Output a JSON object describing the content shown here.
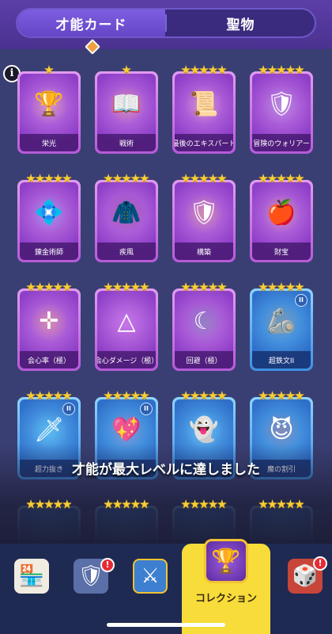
{
  "tabs": [
    {
      "label": "才能カード",
      "active": true
    },
    {
      "label": "聖物",
      "active": false
    }
  ],
  "info_icon": "info-icon",
  "cards": [
    {
      "label": "栄光",
      "stars": 1,
      "icon": "trophy-icon",
      "glyph": "🏆",
      "theme": "purple",
      "art_color": "#f4d35e"
    },
    {
      "label": "戦術",
      "stars": 1,
      "icon": "tactics-book-icon",
      "glyph": "📖",
      "theme": "purple",
      "art_color": "#f6b93b"
    },
    {
      "label": "最後のエキスパート",
      "stars": 5,
      "icon": "scroll-icon",
      "glyph": "📜",
      "theme": "purple",
      "art_color": "#f1d28a"
    },
    {
      "label": "冒険のウォリアー",
      "stars": 5,
      "icon": "armor-icon",
      "glyph": "🛡",
      "theme": "purple",
      "art_color": "#9aa7c4"
    },
    {
      "label": "錬金術師",
      "stars": 5,
      "icon": "alchemy-gem-icon",
      "glyph": "💠",
      "theme": "purple",
      "art_color": "#4fb3f0"
    },
    {
      "label": "疾風",
      "stars": 5,
      "icon": "cape-icon",
      "glyph": "🧥",
      "theme": "purple",
      "art_color": "#6b1f2a"
    },
    {
      "label": "構築",
      "stars": 5,
      "icon": "shield-emblem-icon",
      "glyph": "🛡",
      "theme": "purple",
      "art_color": "#e8b73c"
    },
    {
      "label": "財宝",
      "stars": 5,
      "icon": "golden-apple-icon",
      "glyph": "🍎",
      "theme": "purple",
      "art_color": "#f5c518"
    },
    {
      "label": "会心率（極）",
      "stars": 5,
      "icon": "crosshair-icon",
      "glyph": "✛",
      "theme": "purple",
      "art_color": "#f2b23a"
    },
    {
      "label": "会心ダメージ（極）",
      "stars": 5,
      "icon": "triangle-target-icon",
      "glyph": "△",
      "theme": "purple",
      "art_color": "#c46ae8"
    },
    {
      "label": "回避（極）",
      "stars": 5,
      "icon": "crescent-dash-icon",
      "glyph": "☾",
      "theme": "purple",
      "art_color": "#2e8b7f"
    },
    {
      "label": "超鉄文II",
      "stars": 5,
      "icon": "iron-chest-icon",
      "glyph": "🦾",
      "theme": "blue",
      "art_color": "#b5653a",
      "badge": "II"
    },
    {
      "label": "超力抜き",
      "stars": 5,
      "icon": "sword-icon",
      "glyph": "🗡",
      "theme": "blue",
      "art_color": "#5fd3e8",
      "badge": "II"
    },
    {
      "label": "",
      "stars": 5,
      "icon": "winged-heart-icon",
      "glyph": "💖",
      "theme": "blue",
      "art_color": "#e84a7a",
      "badge": "II"
    },
    {
      "label": "",
      "stars": 5,
      "icon": "angel-ghost-icon",
      "glyph": "👻",
      "theme": "blue",
      "art_color": "#7fd8f5"
    },
    {
      "label": "魔の割引",
      "stars": 5,
      "icon": "devil-heart-icon",
      "glyph": "😈",
      "theme": "blue",
      "art_color": "#d83a3a"
    }
  ],
  "toast": "才能が最大レベルに達しました",
  "nav": {
    "shop_icon": "shop-icon",
    "equipment_icon": "equipment-icon",
    "hero_icon": "hero-shield-icon",
    "collection_label": "コレクション",
    "collection_icon": "collection-chalice-icon",
    "event_icon": "event-board-icon",
    "alert_glyph": "!"
  }
}
